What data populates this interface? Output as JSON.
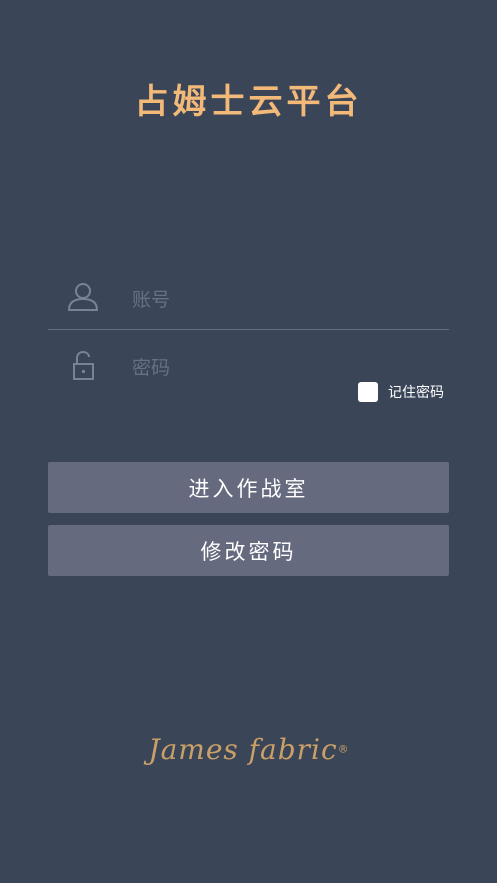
{
  "app": {
    "title": "占姆士云平台"
  },
  "form": {
    "account_placeholder": "账号",
    "password_placeholder": "密码",
    "remember_label": "记住密码",
    "remember_checked": false
  },
  "buttons": {
    "enter_label": "进入作战室",
    "change_password_label": "修改密码"
  },
  "brand": {
    "logo_text": "James fabric",
    "registered_mark": "®"
  },
  "colors": {
    "background": "#3b4558",
    "title": "#f2b978",
    "button": "#656a7e",
    "brand": "#c9a067"
  },
  "icons": {
    "account": "user-icon",
    "password": "lock-icon"
  }
}
